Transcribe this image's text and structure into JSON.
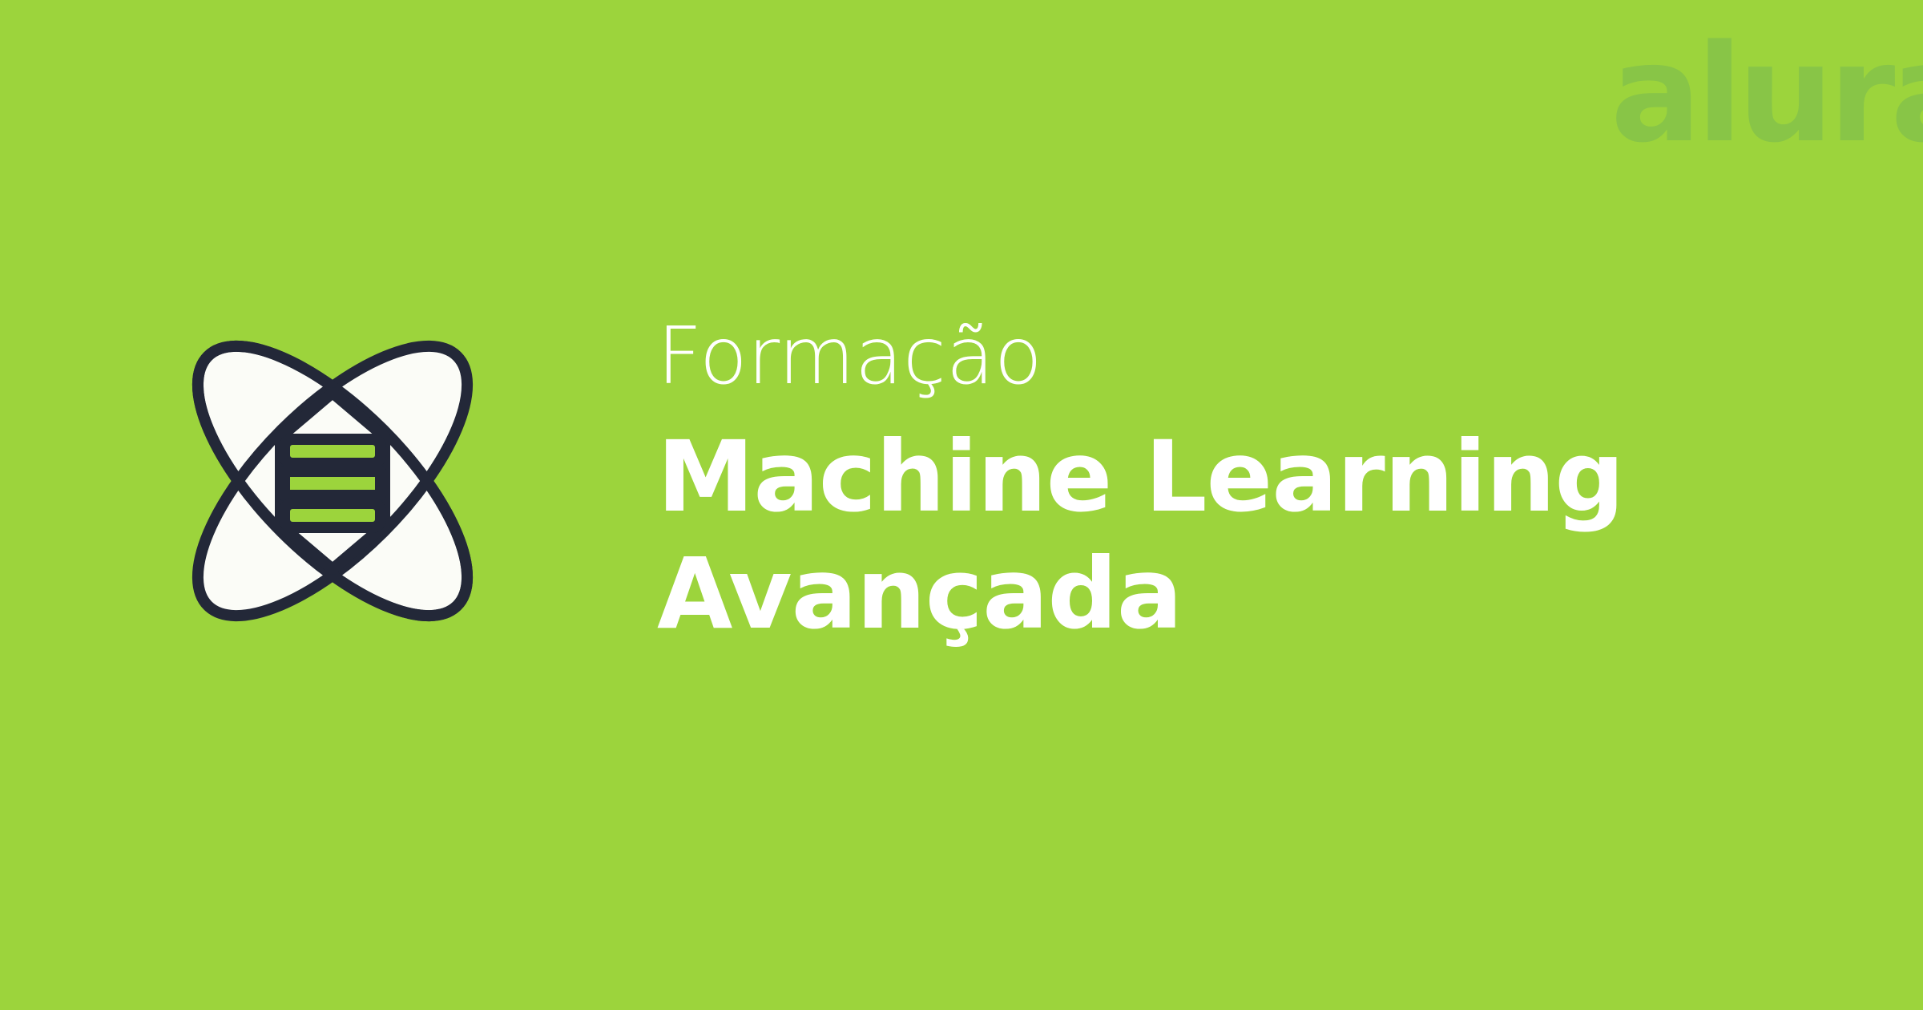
{
  "colors": {
    "background": "#9cd43c",
    "logo": "#88c547",
    "icon_outline": "#232838",
    "icon_fill": "#fbfcf7",
    "icon_accent": "#9cd43c",
    "text": "#ffffff"
  },
  "brand": {
    "logo_text": "alura"
  },
  "hero": {
    "icon": "machine-learning-atom-icon",
    "subtitle": "Formação",
    "title_line1": "Machine Learning",
    "title_line2": "Avançada"
  }
}
